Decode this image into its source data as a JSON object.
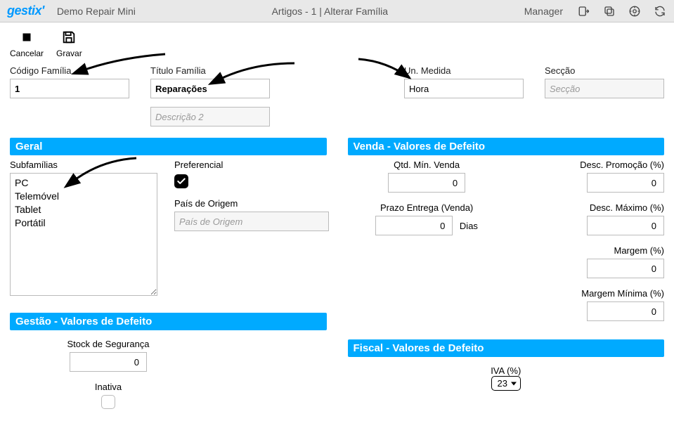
{
  "header": {
    "logo_text": "gestix",
    "demo": "Demo Repair Mini",
    "breadcrumb": "Artigos - 1 | Alterar Família",
    "user": "Manager"
  },
  "toolbar": {
    "cancel_label": "Cancelar",
    "save_label": "Gravar"
  },
  "fields": {
    "codigo_label": "Código Família",
    "codigo_value": "1",
    "titulo_label": "Título Família",
    "titulo_value": "Reparações",
    "desc2_placeholder": "Descrição 2",
    "un_label": "Un. Medida",
    "un_value": "Hora",
    "seccao_label": "Secção",
    "seccao_placeholder": "Secção"
  },
  "geral": {
    "title": "Geral",
    "subfam_label": "Subfamílias",
    "subfam_items": [
      "PC",
      "Telemóvel",
      "Tablet",
      "Portátil"
    ],
    "pref_label": "Preferencial",
    "pref_checked": true,
    "pais_label": "País de Origem",
    "pais_placeholder": "País de Origem"
  },
  "gestao": {
    "title": "Gestão - Valores de Defeito",
    "stock_label": "Stock de Segurança",
    "stock_value": "0",
    "inativa_label": "Inativa"
  },
  "venda": {
    "title": "Venda - Valores de Defeito",
    "qtd_label": "Qtd. Mín. Venda",
    "qtd_value": "0",
    "prazo_label": "Prazo Entrega (Venda)",
    "prazo_value": "0",
    "prazo_suffix": "Dias",
    "desc_promo_label": "Desc. Promoção (%)",
    "desc_promo_value": "0",
    "desc_max_label": "Desc. Máximo (%)",
    "desc_max_value": "0",
    "margem_label": "Margem (%)",
    "margem_value": "0",
    "margem_min_label": "Margem Mínima (%)",
    "margem_min_value": "0"
  },
  "fiscal": {
    "title": "Fiscal - Valores de Defeito",
    "iva_label": "IVA (%)",
    "iva_value": "23"
  }
}
